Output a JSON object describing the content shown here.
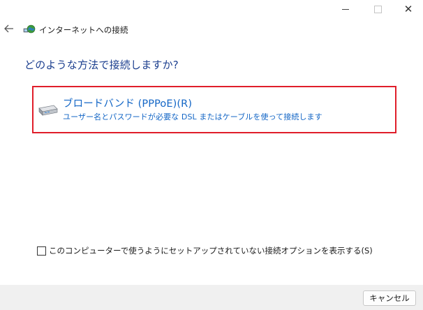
{
  "window": {
    "title": "インターネットへの接続",
    "minimize_icon": "minimize-icon",
    "maximize_icon": "maximize-icon",
    "close_icon": "close-icon",
    "close_glyph": "✕"
  },
  "header": {
    "back_icon": "back-arrow-icon",
    "app_icon": "network-globe-icon"
  },
  "main": {
    "heading": "どのような方法で接続しますか?",
    "option": {
      "icon": "broadband-modem-icon",
      "title": "ブロードバンド (PPPoE)(R)",
      "description": "ユーザー名とパスワードが必要な DSL またはケーブルを使って接続します",
      "highlight_color": "#e01e2a"
    },
    "checkbox": {
      "label": "このコンピューターで使うようにセットアップされていない接続オプションを表示する(S)",
      "checked": false
    }
  },
  "footer": {
    "cancel_label": "キャンセル"
  },
  "colors": {
    "heading": "#1c3f8f",
    "link": "#1366c6",
    "footer_bg": "#f0f0f0"
  }
}
